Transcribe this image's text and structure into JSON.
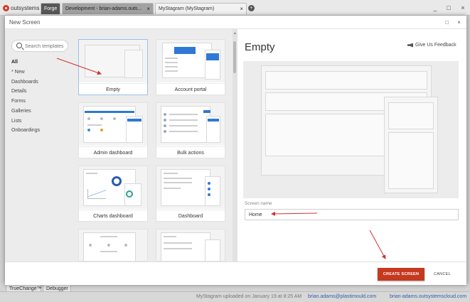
{
  "app": {
    "logo_text": "outsystems",
    "tabs": [
      {
        "label": "Forge"
      },
      {
        "label": "Development - brian-adams.outs..."
      },
      {
        "label": "MyStagram (MyStagram)"
      }
    ],
    "add_tab_icon": "+",
    "window_controls": [
      "_",
      "□",
      "×"
    ]
  },
  "dialog": {
    "title": "New Screen",
    "controls": [
      "□",
      "×"
    ],
    "search": {
      "placeholder": "Search templates",
      "value": ""
    },
    "categories": [
      "All",
      "* New",
      "Dashboards",
      "Details",
      "Forms",
      "Galleries",
      "Lists",
      "Onboardings"
    ],
    "selected_category": "All",
    "templates": [
      {
        "label": "Empty",
        "selected": true
      },
      {
        "label": "Account portal",
        "selected": false
      },
      {
        "label": "Admin dashboard",
        "selected": false
      },
      {
        "label": "Bulk actions",
        "selected": false
      },
      {
        "label": "Charts dashboard",
        "selected": false
      },
      {
        "label": "Dashboard",
        "selected": false
      },
      {
        "label": "",
        "selected": false
      },
      {
        "label": "",
        "selected": false
      }
    ],
    "preview": {
      "title": "Empty",
      "feedback_label": "Give Us Feedback"
    },
    "screen_name": {
      "label": "Screen name",
      "value": "Home"
    },
    "footer": {
      "create_label": "CREATE SCREEN",
      "cancel_label": "CANCEL"
    }
  },
  "bottom": {
    "tabs": [
      "TrueChange™",
      "Debugger"
    ],
    "status": {
      "upload_text": "MyStagram uploaded on January 19 at 8:25 AM",
      "user": "brian.adams@plastimould.com",
      "server": "brian-adams.outsystemscloud.com"
    }
  },
  "colors": {
    "accent": "#c5391e",
    "selection": "#9bc0ec",
    "brand_blue": "#2f78d4",
    "annotation_arrow": "#d32f2f"
  },
  "icons": {
    "logo": "outsystems-logo-icon",
    "search": "search-icon",
    "feedback": "megaphone-icon",
    "close": "close-icon",
    "maximize": "maximize-icon",
    "minimize": "minimize-icon"
  }
}
